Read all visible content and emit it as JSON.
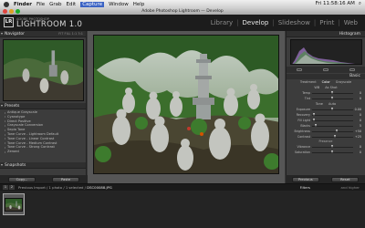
{
  "menubar": {
    "app": "Finder",
    "items": [
      "File",
      "Grab",
      "Edit",
      "Capture",
      "Window",
      "Help"
    ],
    "active_index": 3,
    "clock": "Fri 11:58:16 AM"
  },
  "window": {
    "title": "Adobe Photoshop Lightroom — Develop"
  },
  "identity": {
    "badge": "LR",
    "small_text": "ADOBE PHOTOSHOP",
    "product": "LIGHTROOM 1.0"
  },
  "modules": [
    {
      "label": "Library"
    },
    {
      "label": "Develop",
      "active": true
    },
    {
      "label": "Slideshow"
    },
    {
      "label": "Print"
    },
    {
      "label": "Web"
    }
  ],
  "left_panel": {
    "navigator": {
      "title": "Navigator",
      "options": "FIT  FILL  1:1  3:1"
    },
    "presets": {
      "title": "Presets",
      "items": [
        "Antique Grayscale",
        "Cyanotype",
        "Direct Positive",
        "Grayscale Conversion",
        "Sepia Tone",
        "Tone Curve - Lightroom Default",
        "Tone Curve - Linear Contrast",
        "Tone Curve - Medium Contrast",
        "Tone Curve - Strong Contrast",
        "Zeroed"
      ]
    },
    "snapshots": {
      "title": "Snapshots"
    },
    "buttons": {
      "copy": "Copy...",
      "paste": "Paste"
    }
  },
  "right_panel": {
    "histogram_title": "Histogram",
    "basic_title": "Basic",
    "treatment": {
      "label": "Treatment",
      "options": [
        "Color",
        "Grayscale"
      ]
    },
    "wb": {
      "label": "WB",
      "value": "As Shot"
    },
    "rows_wb": [
      {
        "label": "Temp",
        "value": "0",
        "level": 0.5
      },
      {
        "label": "Tint",
        "value": "0",
        "level": 0.5
      }
    ],
    "tone_label": "Tone",
    "tone_auto": "Auto",
    "rows_tone": [
      {
        "label": "Exposure",
        "value": "0.00",
        "level": 0.5
      },
      {
        "label": "Recovery",
        "value": "0",
        "level": 0.05
      },
      {
        "label": "Fill Light",
        "value": "0",
        "level": 0.05
      },
      {
        "label": "Blacks",
        "value": "5",
        "level": 0.1
      }
    ],
    "rows_bright": [
      {
        "label": "Brightness",
        "value": "+50",
        "level": 0.62
      },
      {
        "label": "Contrast",
        "value": "+25",
        "level": 0.56
      }
    ],
    "presence_label": "Presence",
    "rows_presence": [
      {
        "label": "Vibrance",
        "value": "0",
        "level": 0.5
      },
      {
        "label": "Saturation",
        "value": "0",
        "level": 0.5
      }
    ],
    "buttons": {
      "previous": "Previous",
      "reset": "Reset"
    }
  },
  "filmbar": {
    "nums": [
      "1",
      "2"
    ],
    "path": "Previous Import / 1 photo / 1 selected /",
    "file": "DSC00088.JPG",
    "filter_label": "Filters",
    "filter_tail": "and higher"
  },
  "colors": {
    "accent": "#3b63c4",
    "panel": "#3c3c3c",
    "canvas": "#565656"
  }
}
